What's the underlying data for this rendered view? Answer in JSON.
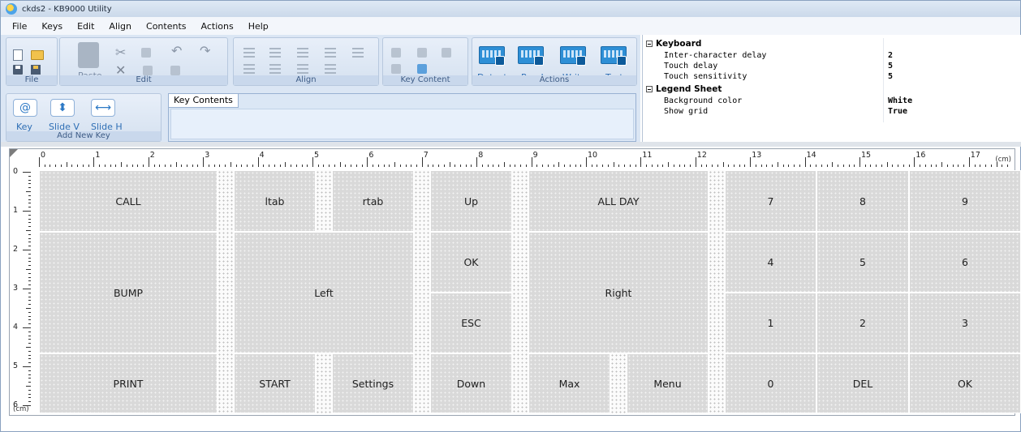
{
  "window": {
    "title": "ckds2 - KB9000 Utility"
  },
  "menu": [
    "File",
    "Keys",
    "Edit",
    "Align",
    "Contents",
    "Actions",
    "Help"
  ],
  "ribbon": {
    "groups": {
      "file": "File",
      "edit": "Edit",
      "align": "Align",
      "key_content": "Key Content",
      "actions": "Actions",
      "add_new_key": "Add New Key"
    },
    "paste_label": "Paste",
    "actions": [
      "Detect",
      "Read",
      "Write",
      "Test"
    ],
    "add_key_buttons": [
      "Key",
      "Slide V",
      "Slide H"
    ],
    "key_contents_tab": "Key Contents"
  },
  "properties": {
    "keyboard_section": "Keyboard",
    "keyboard": [
      {
        "name": "Inter-character delay",
        "value": "2"
      },
      {
        "name": "Touch delay",
        "value": "5"
      },
      {
        "name": "Touch sensitivity",
        "value": "5"
      }
    ],
    "legend_section": "Legend Sheet",
    "legend": [
      {
        "name": "Background color",
        "value": "White"
      },
      {
        "name": "Show grid",
        "value": "True"
      }
    ]
  },
  "ruler": {
    "unit": "(cm)",
    "h_numbers": [
      "0",
      "1",
      "2",
      "3",
      "4",
      "5",
      "6",
      "7",
      "8",
      "9",
      "10",
      "11",
      "12",
      "13",
      "14",
      "15",
      "16",
      "17"
    ],
    "v_numbers": [
      "0",
      "1",
      "2",
      "3",
      "4",
      "5",
      "6"
    ]
  },
  "keys": {
    "call": "CALL",
    "ltab": "ltab",
    "rtab": "rtab",
    "up": "Up",
    "all_day": "ALL DAY",
    "k7": "7",
    "k8": "8",
    "k9": "9",
    "bump": "BUMP",
    "left": "Left",
    "ok_mid": "OK",
    "esc": "ESC",
    "right": "Right",
    "k4": "4",
    "k5": "5",
    "k6": "6",
    "k1": "1",
    "k2": "2",
    "k3": "3",
    "print": "PRINT",
    "start": "START",
    "settings": "Settings",
    "down": "Down",
    "max": "Max",
    "menu": "Menu",
    "k0": "0",
    "del": "DEL",
    "ok_right": "OK"
  }
}
